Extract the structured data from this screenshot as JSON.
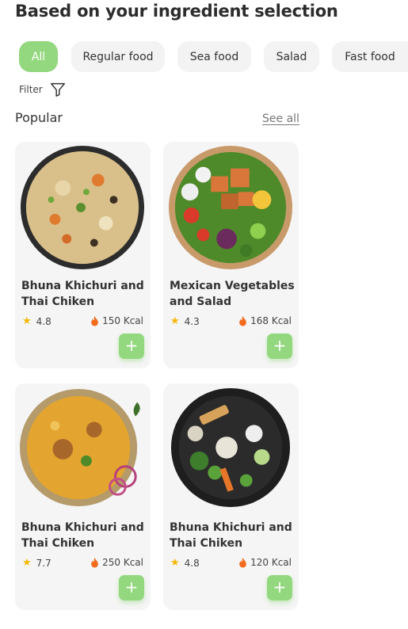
{
  "header": {
    "title": "Based on your ingredient selection"
  },
  "categories": [
    {
      "label": "All",
      "active": true
    },
    {
      "label": "Regular food",
      "active": false
    },
    {
      "label": "Sea food",
      "active": false
    },
    {
      "label": "Salad",
      "active": false
    },
    {
      "label": "Fast food",
      "active": false
    }
  ],
  "filter": {
    "label": "Filter",
    "icon": "filter-funnel-icon"
  },
  "popular": {
    "title": "Popular",
    "see_all": "See all",
    "items": [
      {
        "name": "Bhuna Khichuri and Thai Chiken",
        "rating": "4.8",
        "kcal": "150 Kcal"
      },
      {
        "name": "Mexican Vegetables and Salad",
        "rating": "4.3",
        "kcal": "168 Kcal"
      },
      {
        "name": "Bhuna Khichuri and Thai Chiken",
        "rating": "7.7",
        "kcal": "250 Kcal"
      },
      {
        "name": "Bhuna Khichuri and Thai Chiken",
        "rating": "4.8",
        "kcal": "120 Kcal"
      }
    ]
  },
  "colors": {
    "accent": "#93d87f",
    "card_bg": "#f5f5f5",
    "chip_bg": "#f3f3f3",
    "star": "#f5b800",
    "flame": "#f26b1d"
  }
}
